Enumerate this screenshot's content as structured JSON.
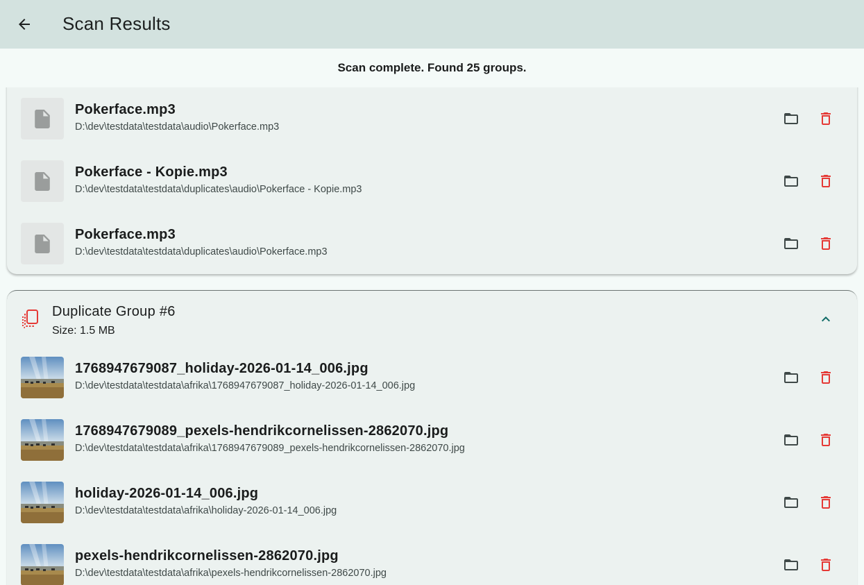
{
  "appbar": {
    "title": "Scan Results",
    "back_icon": "arrow-back-icon"
  },
  "status": {
    "text": "Scan complete. Found 25 groups."
  },
  "colors": {
    "appbar_bg": "#d3e2df",
    "page_bg": "#f4faf8",
    "card_bg": "#ecf2f0",
    "delete_red": "#e53935",
    "accent_teal": "#0f6b66"
  },
  "previous_group": {
    "files": [
      {
        "name": "Pokerface.mp3",
        "path": "D:\\dev\\testdata\\testdata\\audio\\Pokerface.mp3",
        "thumb": "file-icon"
      },
      {
        "name": "Pokerface - Kopie.mp3",
        "path": "D:\\dev\\testdata\\testdata\\duplicates\\audio\\Pokerface - Kopie.mp3",
        "thumb": "file-icon"
      },
      {
        "name": "Pokerface.mp3",
        "path": "D:\\dev\\testdata\\testdata\\duplicates\\audio\\Pokerface.mp3",
        "thumb": "file-icon"
      }
    ]
  },
  "group6": {
    "title": "Duplicate Group #6",
    "size": "Size: 1.5 MB",
    "icon": "duplicate-icon",
    "collapse_icon": "chevron-up-icon",
    "files": [
      {
        "name": "1768947679087_holiday-2026-01-14_006.jpg",
        "path": "D:\\dev\\testdata\\testdata\\afrika\\1768947679087_holiday-2026-01-14_006.jpg",
        "thumb": "image-thumbnail"
      },
      {
        "name": "1768947679089_pexels-hendrikcornelissen-2862070.jpg",
        "path": "D:\\dev\\testdata\\testdata\\afrika\\1768947679089_pexels-hendrikcornelissen-2862070.jpg",
        "thumb": "image-thumbnail"
      },
      {
        "name": "holiday-2026-01-14_006.jpg",
        "path": "D:\\dev\\testdata\\testdata\\afrika\\holiday-2026-01-14_006.jpg",
        "thumb": "image-thumbnail"
      },
      {
        "name": "pexels-hendrikcornelissen-2862070.jpg",
        "path": "D:\\dev\\testdata\\testdata\\afrika\\pexels-hendrikcornelissen-2862070.jpg",
        "thumb": "image-thumbnail"
      }
    ]
  }
}
